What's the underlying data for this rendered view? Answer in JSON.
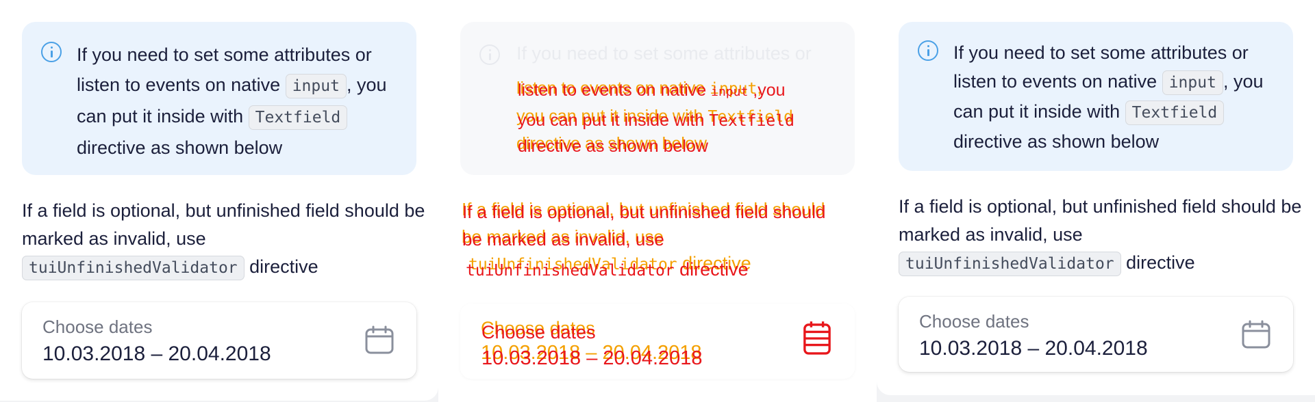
{
  "notification": {
    "text_1": "If you need to set some attributes or listen to events on native",
    "code_input": "input",
    "text_2": ", you can put it inside with",
    "code_textfield": "Textfield",
    "text_3": "directive as shown below",
    "line_1": "If you need to set some attributes or",
    "line_2": "listen to events on native",
    "line_3": "you can put it inside with",
    "line_4": "directive as shown below",
    "comma": ","
  },
  "description": {
    "text_1": "If a field is optional, but unfinished field should be marked as invalid, use",
    "line_1": "If a field is optional, but unfinished field should",
    "line_2": "be marked as invalid, use",
    "code_validator": "tuiUnfinishedValidator",
    "text_2": "directive"
  },
  "date_field": {
    "label": "Choose dates",
    "value": "10.03.2018 – 20.04.2018",
    "icon": "calendar-icon"
  },
  "colors": {
    "notification_bg": "#eaf3fd",
    "info_icon": "#4aa0e6",
    "diff_red": "#e8161b",
    "diff_orange": "#f4a000"
  }
}
